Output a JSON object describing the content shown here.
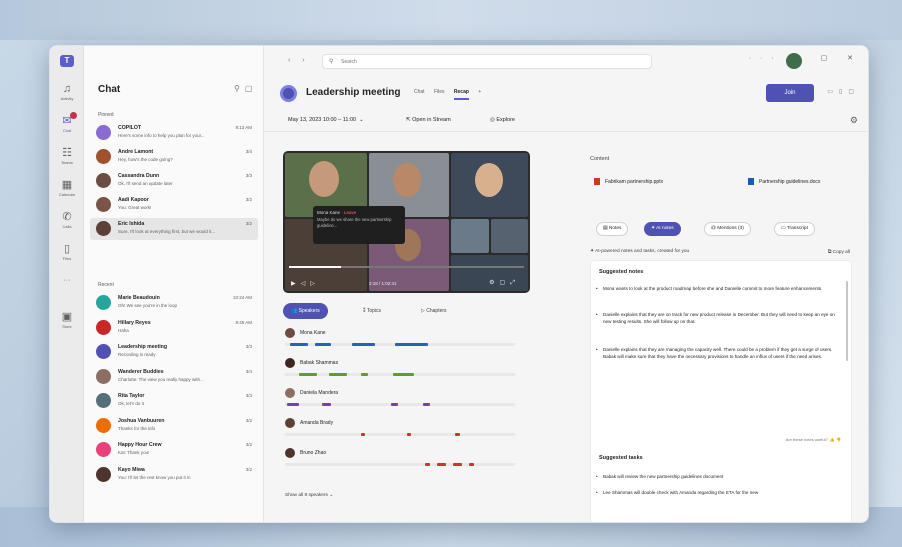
{
  "window": {
    "search_placeholder": "Search",
    "nav_arrows": "‹ ›",
    "window_controls": "··· — ▢ ✕"
  },
  "rail": [
    {
      "label": "Activity",
      "icon": "bell-icon"
    },
    {
      "label": "Chat",
      "icon": "chat-icon"
    },
    {
      "label": "Teams",
      "icon": "teams-icon"
    },
    {
      "label": "Calendar",
      "icon": "calendar-icon"
    },
    {
      "label": "Calls",
      "icon": "phone-icon"
    },
    {
      "label": "Files",
      "icon": "file-icon"
    },
    {
      "label": "···",
      "icon": "more-icon"
    },
    {
      "label": "Store",
      "icon": "apps-icon"
    }
  ],
  "chat": {
    "title": "Chat",
    "pinned_label": "Pinned",
    "recent_label": "Recent",
    "pinned": [
      {
        "name": "COPILOT",
        "preview": "Here's some info to help you plan for your...",
        "time": "9:13 AM",
        "color": "#8a6bd1"
      },
      {
        "name": "Andre Lamont",
        "preview": "Hey, how's the code going?",
        "time": "3/4",
        "color": "#a0522d"
      },
      {
        "name": "Cassandra Dunn",
        "preview": "Ok, I'll send an update later",
        "time": "3/3",
        "color": "#6d4c41"
      },
      {
        "name": "Aadi Kapoor",
        "preview": "You: Great work!",
        "time": "3/2",
        "color": "#795548"
      },
      {
        "name": "Eric Ishida",
        "preview": "Sure, I'll look at everything first, but we would it...",
        "time": "3/2",
        "color": "#5d4037"
      }
    ],
    "recent": [
      {
        "name": "Marie Beaudouin",
        "preview": "Oh! We see you're in the loop",
        "time": "10:24 AM",
        "color": "#26a69a"
      },
      {
        "name": "Hillary Reyes",
        "preview": "Haha",
        "time": "8:45 AM",
        "color": "#c62828"
      },
      {
        "name": "Leadership meeting",
        "preview": "Recording is ready",
        "time": "3/3",
        "color": "#4f52b2"
      },
      {
        "name": "Wanderer Buddies",
        "preview": "Charlotte: The view you really happy with...",
        "time": "3/4",
        "color": "#8d6e63"
      },
      {
        "name": "Rita Taylor",
        "preview": "Ok, let's do it",
        "time": "3/3",
        "color": "#546e7a"
      },
      {
        "name": "Joshua Vanbuuren",
        "preview": "Thanks for the info",
        "time": "3/2",
        "color": "#ef6c00"
      },
      {
        "name": "Happy Hour Crew",
        "preview": "Kat: Thank you!",
        "time": "3/2",
        "color": "#ec407a"
      },
      {
        "name": "Kayo Miwa",
        "preview": "You: I'll let the rest know you put it in",
        "time": "3/2",
        "color": "#4e342e"
      }
    ]
  },
  "meeting": {
    "title": "Leadership meeting",
    "tabs": [
      "Chat",
      "Files",
      "Recap",
      "+"
    ],
    "active_tab": "Recap",
    "join_label": "Join",
    "date": "May 13, 2023 10:00 – 11:00",
    "open_in_stream": "Open in Stream",
    "explore": "Explore",
    "video": {
      "tooltip_name": "Mona Kane",
      "tooltip_status": "· Leave",
      "tooltip_text": "Maybe do we share the new partnership guideline...",
      "progress": 0.22,
      "time": "2:18 / 1:02:41"
    },
    "speaker_tabs": [
      "Speakers",
      "Topics",
      "Chapters"
    ],
    "speakers": [
      {
        "name": "Mona Kane",
        "color": "#2f5fb0",
        "segments": [
          [
            0.02,
            0.1
          ],
          [
            0.13,
            0.2
          ],
          [
            0.29,
            0.39
          ],
          [
            0.48,
            0.62
          ]
        ]
      },
      {
        "name": "Babak Shammas",
        "color": "#5c9b35",
        "segments": [
          [
            0.06,
            0.14
          ],
          [
            0.19,
            0.27
          ],
          [
            0.33,
            0.36
          ],
          [
            0.47,
            0.56
          ]
        ]
      },
      {
        "name": "Daniela Mandera",
        "color": "#7b3fa0",
        "segments": [
          [
            0.01,
            0.06
          ],
          [
            0.16,
            0.2
          ],
          [
            0.46,
            0.49
          ],
          [
            0.6,
            0.63
          ]
        ]
      },
      {
        "name": "Amanda Brady",
        "color": "#c0392b",
        "segments": [
          [
            0.33,
            0.35
          ],
          [
            0.53,
            0.55
          ],
          [
            0.74,
            0.76
          ]
        ]
      },
      {
        "name": "Bruno Zhao",
        "color": "#c0392b",
        "segments": [
          [
            0.61,
            0.63
          ],
          [
            0.66,
            0.7
          ],
          [
            0.73,
            0.77
          ],
          [
            0.8,
            0.82
          ]
        ]
      }
    ],
    "show_all": "Show all 8 speakers ⌄"
  },
  "recap": {
    "content_label": "Content",
    "files": [
      "Fabrikam partnership.pptx",
      "Partnership guidelines.docx"
    ],
    "tabs": [
      "Notes",
      "AI notes",
      "Mentions (3)",
      "Transcript"
    ],
    "active_tab": "AI notes",
    "ai_line": "AI-powered notes and tasks, created for you",
    "copy_all": "Copy all",
    "suggested_notes_title": "Suggested notes",
    "notes": [
      "Mona wants to look at the product roadmap before she and Danielle commit to more feature enhancements.",
      "Danielle explains that they are on track for new product release in December. But they will need to keep an eye on new testing results. She will follow up on that.",
      "Danielle explains that they are managing the capacity well. There could be a problem if they get a surge of users. Babak will make sure that they have the necessary provisions to handle an influx of users if the need arises."
    ],
    "useful_prompt": "Are these notes useful?",
    "suggested_tasks_title": "Suggested tasks",
    "tasks": [
      "Babak will review the new partnership guidelines document",
      "Lee Shammas will double check with Amanda regarding the ETA for the new"
    ]
  }
}
